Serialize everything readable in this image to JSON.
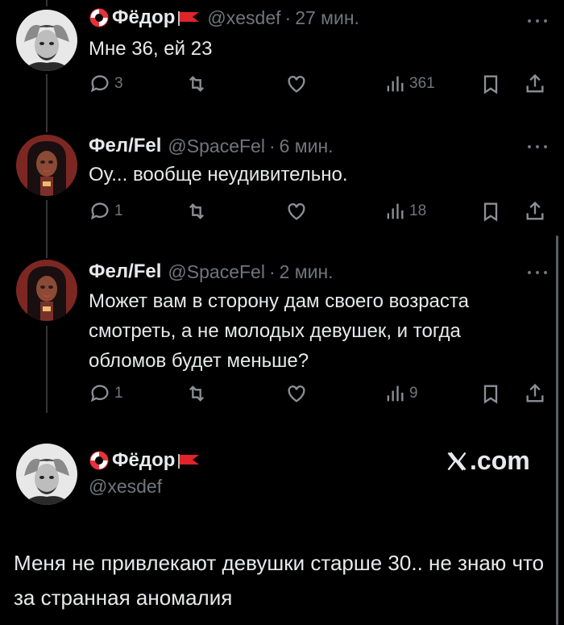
{
  "tweets": [
    {
      "name": "Фёдор",
      "handle": "@xesdef",
      "separator": "·",
      "time": "27 мин.",
      "text": "Мне 36, ей 23",
      "replies": "3",
      "views": "361"
    },
    {
      "name": "Фел/Fel",
      "handle": "@SpaceFel",
      "separator": "·",
      "time": "6 мин.",
      "text": "Оу... вообще неудивительно.",
      "replies": "1",
      "views": "18"
    },
    {
      "name": "Фел/Fel",
      "handle": "@SpaceFel",
      "separator": "·",
      "time": "2 мин.",
      "text": "Может вам в сторону дам своего возраста смотреть, а не молодых девушек, и тогда обломов будет меньше?",
      "replies": "1",
      "views": "9"
    }
  ],
  "card": {
    "name": "Фёдор",
    "handle": "@xesdef",
    "brand": ".com",
    "text": "Меня не привлекают девушки старше 30.. не знаю что за странная аномалия"
  },
  "icons": {
    "reply": "reply-icon",
    "repost": "repost-icon",
    "like": "like-icon",
    "views": "views-icon",
    "bookmark": "bookmark-icon",
    "share": "share-icon",
    "more": "more-icon",
    "lifebuoy": "lifebuoy-icon",
    "flag": "flag-icon",
    "x_logo": "x-logo-icon"
  },
  "colors": {
    "background": "#000000",
    "text": "#e7e9ea",
    "muted": "#71767b",
    "flag": "#e0242a",
    "lifebuoy_red": "#e8323a"
  }
}
